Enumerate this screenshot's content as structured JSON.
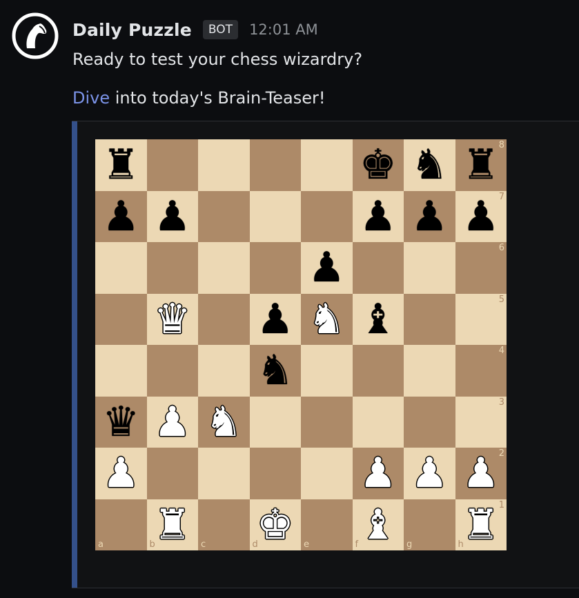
{
  "author": {
    "name": "Daily Puzzle",
    "badge": "BOT",
    "avatar_icon": "knight-logo-icon"
  },
  "message": {
    "timestamp": "12:01 AM",
    "line1": "Ready to test your chess wizardry?",
    "link_text": "Dive",
    "line2_rest": " into today's Brain-Teaser!"
  },
  "colors": {
    "link": "#7b93e8",
    "embed_bar": "#34508a",
    "board_light": "#ecd8b4",
    "board_dark": "#ad8a68"
  },
  "board": {
    "files": [
      "a",
      "b",
      "c",
      "d",
      "e",
      "f",
      "g",
      "h"
    ],
    "ranks": [
      "8",
      "7",
      "6",
      "5",
      "4",
      "3",
      "2",
      "1"
    ],
    "rows": [
      [
        "bR",
        "",
        "",
        "",
        "",
        "bK",
        "bN",
        "bR"
      ],
      [
        "bP",
        "bP",
        "",
        "",
        "",
        "bP",
        "bP",
        "bP"
      ],
      [
        "",
        "",
        "",
        "",
        "bP",
        "",
        "",
        ""
      ],
      [
        "",
        "wQ",
        "",
        "bP",
        "wN",
        "bB",
        "",
        ""
      ],
      [
        "",
        "",
        "",
        "bN",
        "",
        "",
        "",
        ""
      ],
      [
        "bQ",
        "wP",
        "wN",
        "",
        "",
        "",
        "",
        ""
      ],
      [
        "wP",
        "",
        "",
        "",
        "",
        "wP",
        "wP",
        "wP"
      ],
      [
        "",
        "wR",
        "",
        "wK",
        "",
        "wB",
        "",
        "wR"
      ]
    ]
  }
}
